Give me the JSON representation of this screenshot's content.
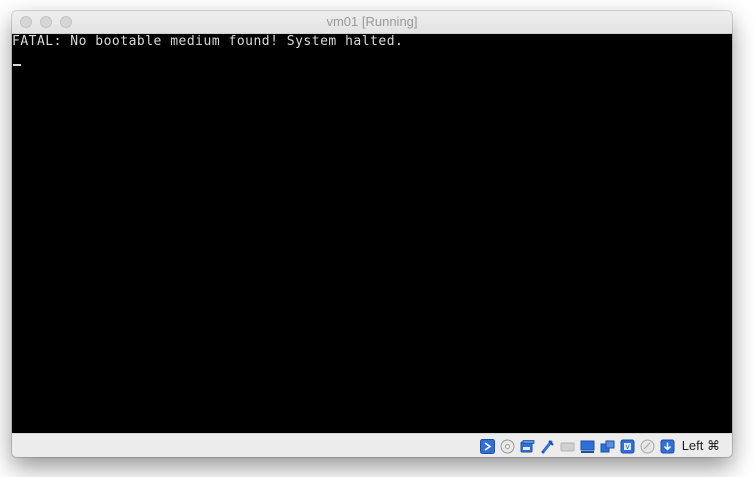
{
  "window": {
    "title": "vm01 [Running]"
  },
  "console": {
    "line1": "FATAL: No bootable medium found! System halted."
  },
  "statusbar": {
    "icons": [
      "storage-icon",
      "optical-drive-icon",
      "floppy-icon",
      "usb-icon",
      "shared-folders-icon",
      "display-icon",
      "network-icon",
      "cpu-icon",
      "recording-icon",
      "mouse-integration-icon"
    ],
    "host_key": "Left ⌘"
  },
  "colors": {
    "screen": "#000000",
    "text": "#d9d9d9",
    "chrome": "#ececec",
    "accent": "#2f6fd6"
  }
}
